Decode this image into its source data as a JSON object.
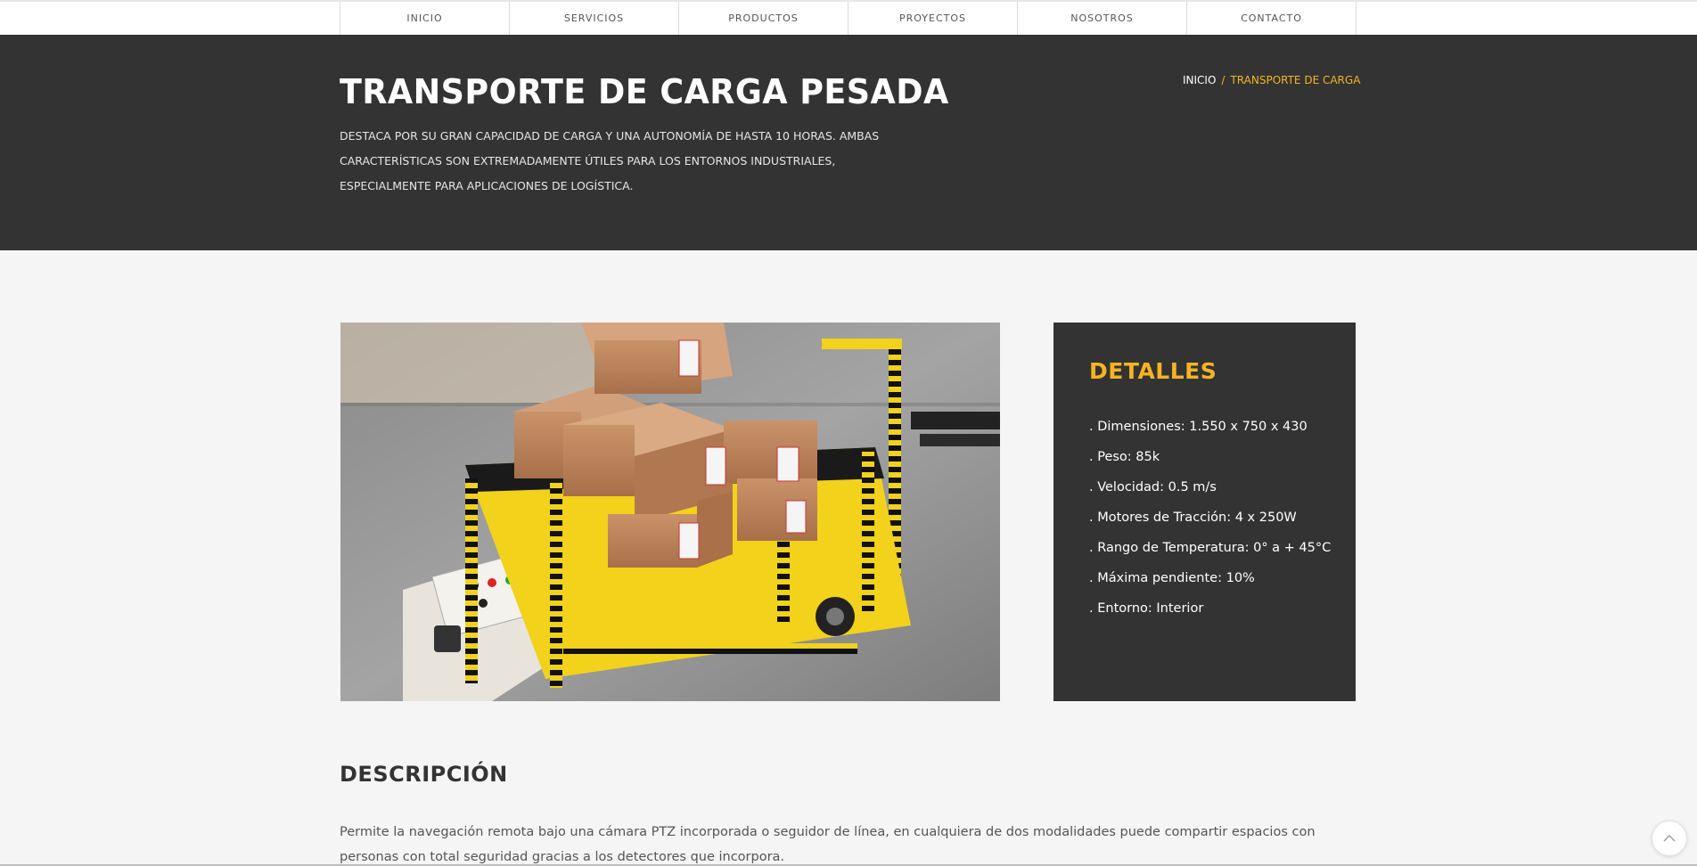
{
  "nav": {
    "items": [
      {
        "label": "INICIO"
      },
      {
        "label": "SERVICIOS"
      },
      {
        "label": "PRODUCTOS"
      },
      {
        "label": "PROYECTOS"
      },
      {
        "label": "NOSOTROS"
      },
      {
        "label": "CONTACTO"
      }
    ]
  },
  "hero": {
    "title": "TRANSPORTE DE CARGA PESADA",
    "text": "DESTACA POR SU GRAN CAPACIDAD DE CARGA Y UNA AUTONOMÍA DE HASTA 10 HORAS. AMBAS CARACTERÍSTICAS SON EXTREMADAMENTE ÚTILES PARA LOS ENTORNOS INDUSTRIALES, ESPECIALMENTE PARA APLICACIONES DE LOGÍSTICA.",
    "breadcrumb": {
      "home": "INICIO",
      "separator": "/",
      "current": "TRANSPORTE DE CARGA"
    }
  },
  "details": {
    "title": "DETALLES",
    "items": [
      ". Dimensiones: 1.550 x 750 x 430",
      ". Peso: 85k",
      ". Velocidad: 0.5 m/s",
      ". Motores de Tracción: 4 x 250W",
      ". Rango de Temperatura: 0° a + 45°C",
      ". Máxima pendiente: 10%",
      ". Entorno: Interior"
    ]
  },
  "description": {
    "title": "DESCRIPCIÓN",
    "text": "Permite la navegación remota bajo una cámara PTZ incorporada o seguidor de línea, en cualquiera de dos modalidades puede compartir espacios con personas con total seguridad gracias a los detectores que incorpora."
  },
  "colors": {
    "accent": "#f5b323",
    "dark": "#333333",
    "background": "#f5f5f5"
  },
  "icons": {
    "scroll_top": "chevron-up-icon"
  }
}
